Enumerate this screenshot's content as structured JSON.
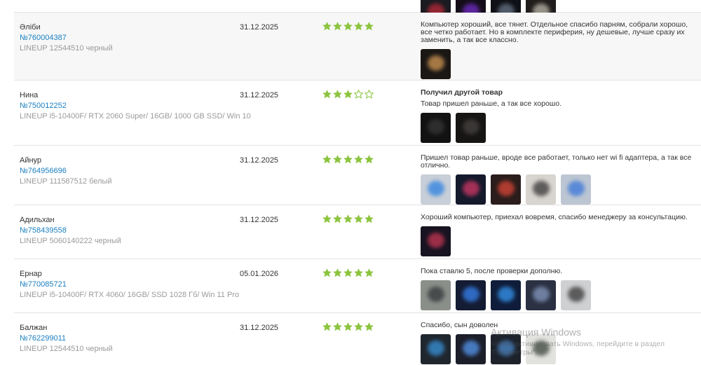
{
  "reviews": [
    {
      "name": "",
      "order": "",
      "model": "",
      "date": "",
      "rating": 0,
      "title": "",
      "text": "",
      "photos": [
        {
          "bg": "#1b1b22",
          "glow": "#c62a3a"
        },
        {
          "bg": "#150e1a",
          "glow": "#7a2fd6"
        },
        {
          "bg": "#0f1116",
          "glow": "#6d7a8c"
        },
        {
          "bg": "#201d1c",
          "glow": "#c9c3b6"
        }
      ]
    },
    {
      "name": "Əліби",
      "order": "№760004387",
      "model": "LINEUP 12544510 черный",
      "date": "31.12.2025",
      "rating": 5,
      "title": "",
      "text": "Компьютер хороший, все тянет. Отдельное спасибо парням, собрали хорошо, все четко работает. Но в комплекте периферия, ну дешевые, лучше сразу их заменить, а так все классно.",
      "photos": [
        {
          "bg": "#1a1715",
          "glow": "#e0a15a"
        }
      ]
    },
    {
      "name": "Нина",
      "order": "№750012252",
      "model": "LINEUP i5-10400F/ RTX 2060 Super/ 16GB/ 1000 GB SSD/ Win 10",
      "date": "31.12.2025",
      "rating": 3,
      "title": "Получил другой товар",
      "text": "Товар пришел раньше, а так все хорошо.",
      "photos": [
        {
          "bg": "#121212",
          "glow": "#3a3a3a"
        },
        {
          "bg": "#161514",
          "glow": "#4a4644"
        }
      ]
    },
    {
      "name": "Айнур",
      "order": "№764956696",
      "model": "LINEUP 111587512 белый",
      "date": "31.12.2025",
      "rating": 5,
      "title": "",
      "text": "Пришел товар раньше, вроде все работает, только нет wi fi адаптера, а так все отлично.",
      "photos": [
        {
          "bg": "#c9cfd8",
          "glow": "#1f7be0"
        },
        {
          "bg": "#141a2c",
          "glow": "#e23b6a"
        },
        {
          "bg": "#2a1d1b",
          "glow": "#e84a3a"
        },
        {
          "bg": "#d8d4cf",
          "glow": "#2a2a2a"
        },
        {
          "bg": "#bcc6d3",
          "glow": "#2f6fd9"
        }
      ]
    },
    {
      "name": "Адильхан",
      "order": "№758439558",
      "model": "LINEUP 5060140222 черный",
      "date": "31.12.2025",
      "rating": 5,
      "title": "",
      "text": "Хороший компьютер, приехал вовремя, спасибо менеджеру за консультацию.",
      "photos": [
        {
          "bg": "#171320",
          "glow": "#d43a5a"
        }
      ]
    },
    {
      "name": "Ернар",
      "order": "№770085721",
      "model": "LINEUP i5-10400F/ RTX 4060/ 16GB/ SSD 1028 Гб/ Win 11 Pro",
      "date": "05.01.2026",
      "rating": 5,
      "title": "",
      "text": "Пока ставлю 5, после проверки дополню.",
      "photos": [
        {
          "bg": "#8b8f8a",
          "glow": "#2d2f33"
        },
        {
          "bg": "#141c33",
          "glow": "#3a8bff"
        },
        {
          "bg": "#0f1d3a",
          "glow": "#3aa0ff"
        },
        {
          "bg": "#2b3142",
          "glow": "#8aa0c8"
        },
        {
          "bg": "#cfd0d2",
          "glow": "#2b2b2b"
        }
      ]
    },
    {
      "name": "Балжан",
      "order": "№762299011",
      "model": "LINEUP 12544510 черный",
      "date": "31.12.2025",
      "rating": 5,
      "title": "",
      "text": "Спасибо, сын доволен",
      "photos": [
        {
          "bg": "#20262e",
          "glow": "#3a9be8"
        },
        {
          "bg": "#1c1f2a",
          "glow": "#5aa0ff"
        },
        {
          "bg": "#1d222b",
          "glow": "#4d8fd6"
        },
        {
          "bg": "#e2e2df",
          "glow": "#2f3a2f"
        }
      ]
    }
  ],
  "watermark": {
    "line1": "Активация Windows",
    "line2": "Чтобы активировать Windows, перейдите в раздел \"Параметры\"."
  },
  "colors": {
    "star_filled": "#8cc43f",
    "star_empty": "#8cc43f",
    "link": "#1a7fc1",
    "muted": "#9a9a9a"
  }
}
